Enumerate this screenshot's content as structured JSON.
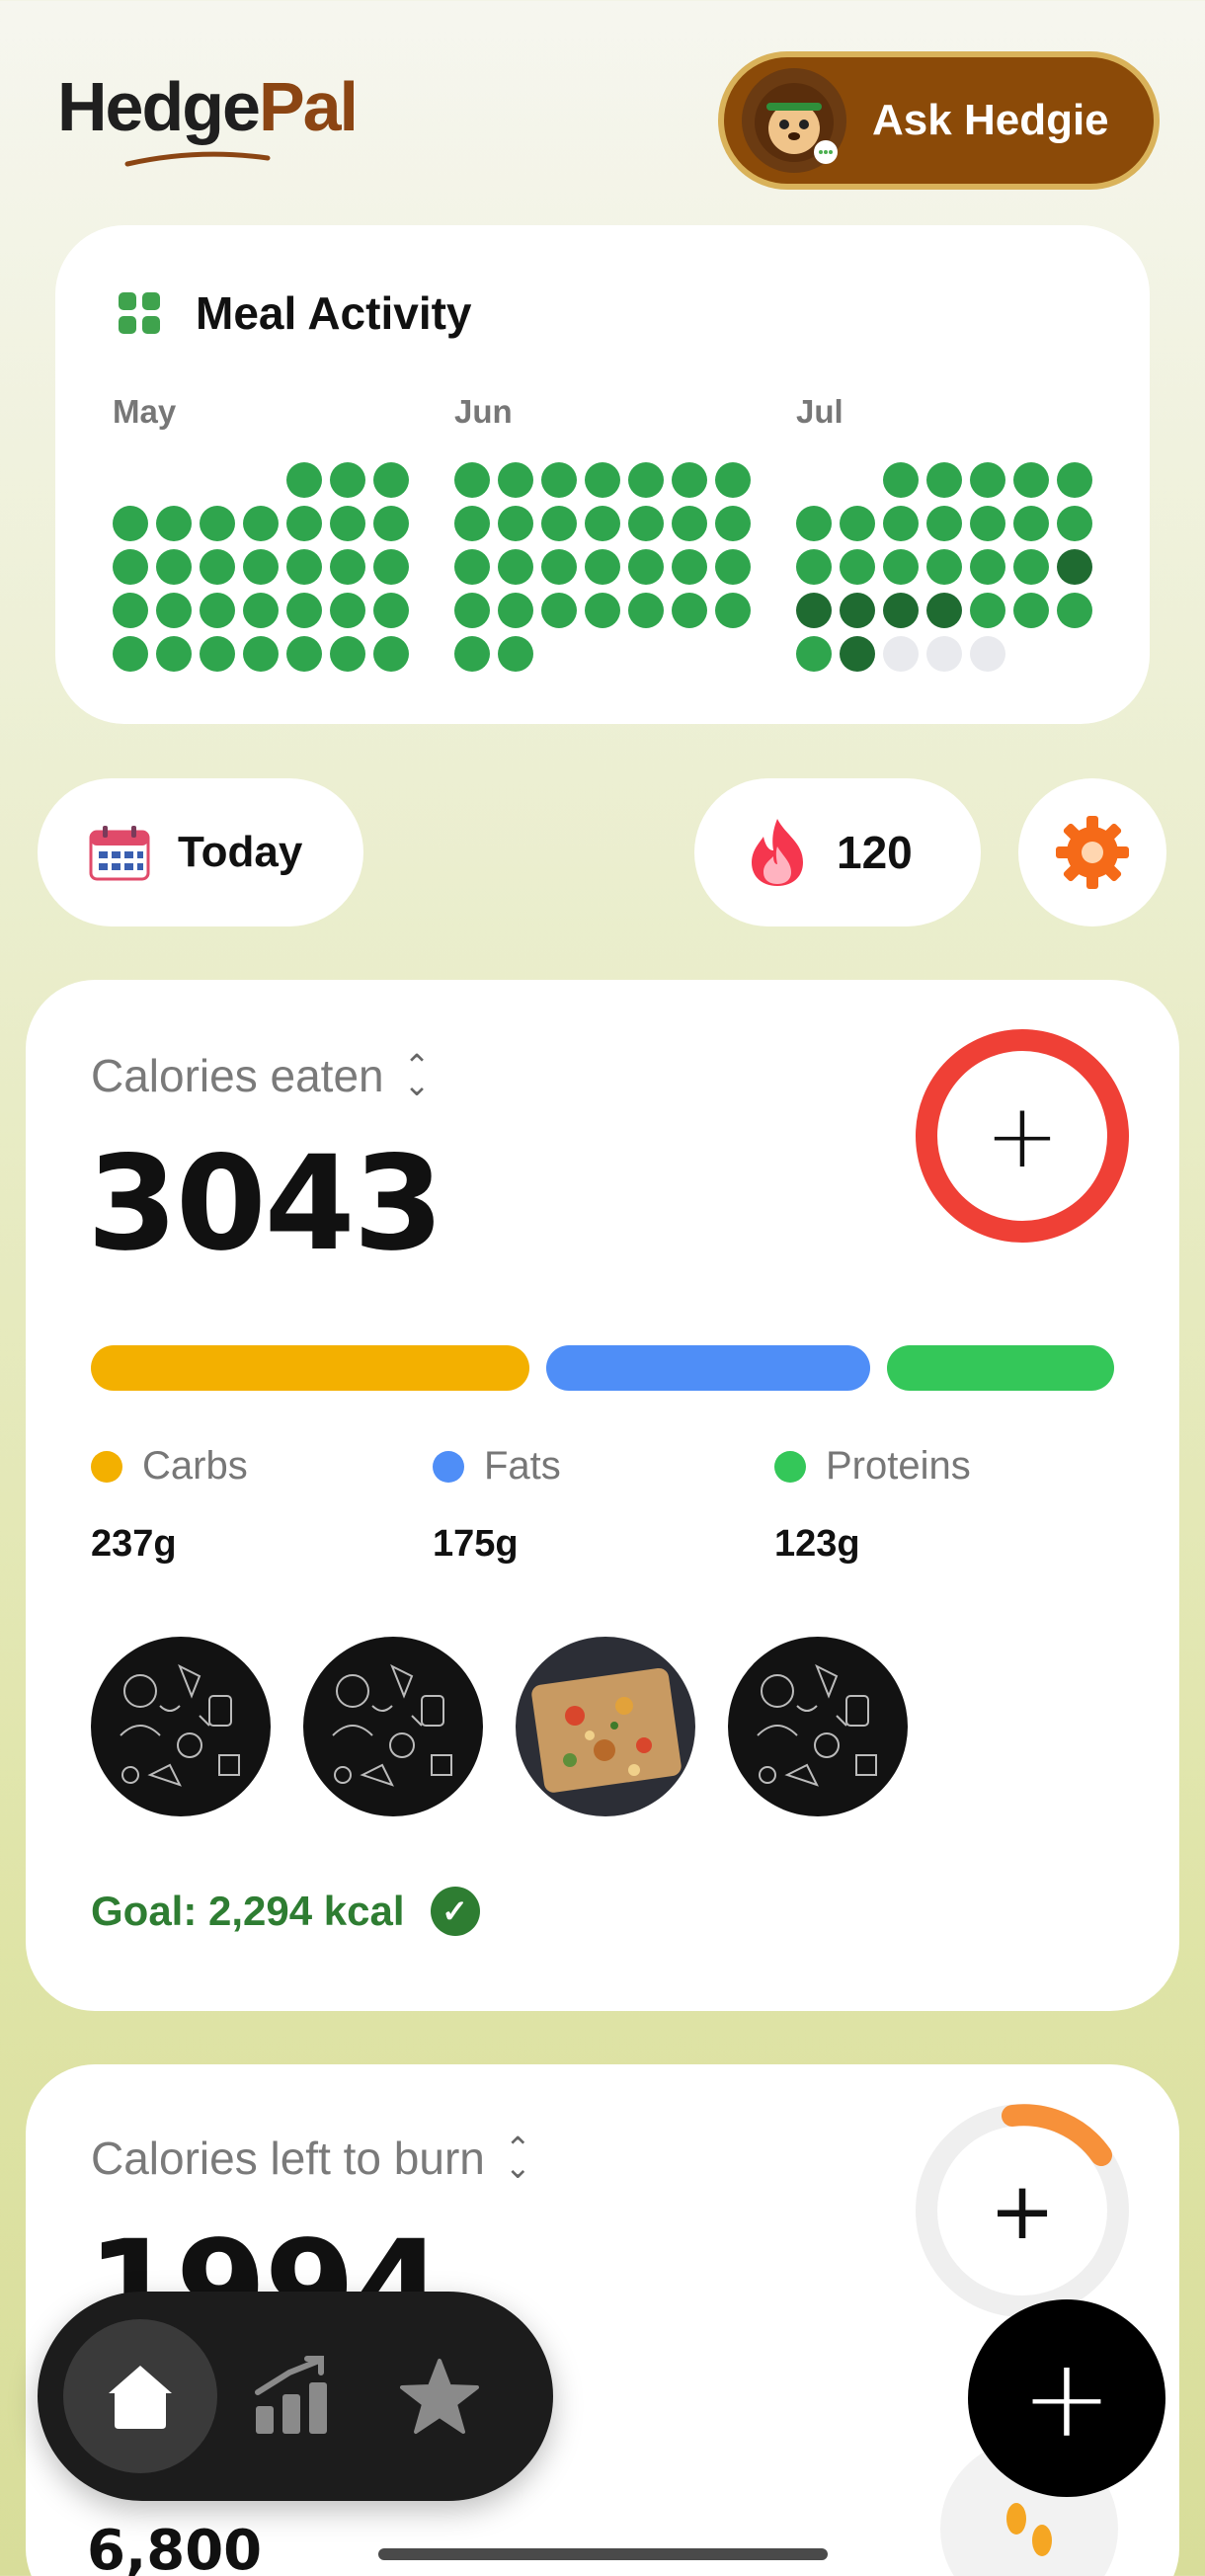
{
  "header": {
    "logo_part1": "Hedge",
    "logo_part2": "Pal",
    "ask_button_label": "Ask Hedgie"
  },
  "meal_activity": {
    "title": "Meal Activity",
    "months": [
      "May",
      "Jun",
      "Jul"
    ],
    "grids": [
      {
        "cols": [
          [
            0,
            1,
            1,
            1,
            1
          ],
          [
            0,
            1,
            1,
            1,
            1
          ],
          [
            0,
            1,
            1,
            1,
            1
          ],
          [
            0,
            1,
            1,
            1,
            1
          ],
          [
            1,
            1,
            1,
            1,
            1
          ],
          [
            1,
            1,
            1,
            1,
            1
          ],
          [
            1,
            1,
            1,
            1,
            1
          ]
        ]
      },
      {
        "cols": [
          [
            1,
            1,
            1,
            1,
            1
          ],
          [
            1,
            1,
            1,
            1,
            1
          ],
          [
            1,
            1,
            1,
            1,
            0
          ],
          [
            1,
            1,
            1,
            1,
            0
          ],
          [
            1,
            1,
            1,
            1,
            0
          ],
          [
            1,
            1,
            1,
            1,
            0
          ],
          [
            1,
            1,
            1,
            1,
            0
          ]
        ]
      },
      {
        "cols": [
          [
            0,
            1,
            1,
            2,
            1
          ],
          [
            0,
            1,
            1,
            2,
            2
          ],
          [
            1,
            1,
            1,
            2,
            3
          ],
          [
            1,
            1,
            1,
            2,
            3
          ],
          [
            1,
            1,
            1,
            1,
            3
          ],
          [
            1,
            1,
            1,
            1,
            0
          ],
          [
            1,
            1,
            2,
            1,
            0
          ]
        ]
      }
    ]
  },
  "controls": {
    "today_label": "Today",
    "streak_count": "120"
  },
  "calories_eaten": {
    "label": "Calories eaten",
    "value": "3043",
    "macros": [
      {
        "name": "Carbs",
        "value": "237g",
        "color": "#f3b000"
      },
      {
        "name": "Fats",
        "value": "175g",
        "color": "#4f8ef7"
      },
      {
        "name": "Proteins",
        "value": "123g",
        "color": "#34c759"
      }
    ],
    "goal_text": "Goal: 2,294 kcal"
  },
  "calories_burn": {
    "label": "Calories left to burn",
    "value": "1994",
    "steps_value": "6,800"
  },
  "colors": {
    "accent_red": "#ef4036",
    "brand_brown": "#8b4a08",
    "activity_green": "#2fa54d",
    "activity_dark": "#1f6b31",
    "goal_green": "#2e7d32"
  },
  "nav": {
    "items": [
      "home-icon",
      "chart-icon",
      "star-icon"
    ]
  }
}
